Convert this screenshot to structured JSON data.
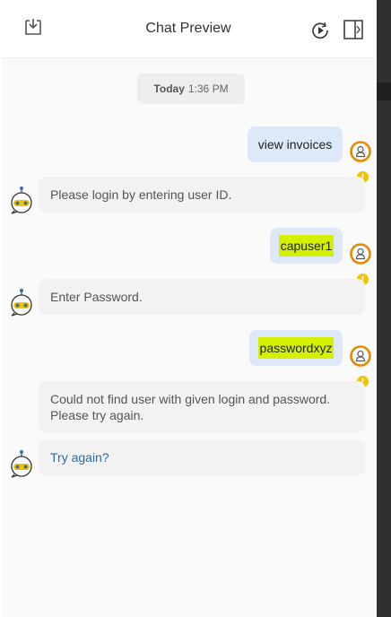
{
  "header": {
    "title": "Chat Preview",
    "left_icon": "inbox-tray-icon",
    "right_icons": [
      "play-circle-icon",
      "panel-collapse-icon"
    ]
  },
  "chat": {
    "date_label_bold": "Today",
    "date_label_time": "1:36 PM",
    "messages": [
      {
        "from": "user",
        "text": "view invoices",
        "highlight": false
      },
      {
        "from": "bot",
        "text": "Please login by entering user ID."
      },
      {
        "from": "user",
        "text": "capuser1",
        "highlight": true
      },
      {
        "from": "bot",
        "text": "Enter Password."
      },
      {
        "from": "user",
        "text": "passwordxyz",
        "highlight": true
      },
      {
        "from": "bot",
        "text": "Could not find user with given login and password. Please try again."
      },
      {
        "from": "bot",
        "text": "Try again?",
        "link": true
      }
    ]
  },
  "colors": {
    "user_bubble": "#dde9f8",
    "bot_bubble": "#f2f2f2",
    "highlight": "#d4f000",
    "user_avatar_ring": "#e58a00",
    "warning": "#f2c300",
    "link": "#2f6aa8"
  }
}
